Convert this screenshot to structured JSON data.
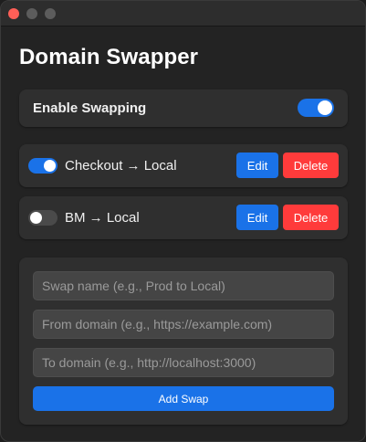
{
  "window": {
    "title": "Domain Swapper"
  },
  "settings": {
    "enable_label": "Enable Swapping",
    "enabled": true
  },
  "swaps": [
    {
      "name": "Checkout → Local",
      "enabled": true,
      "edit_label": "Edit",
      "delete_label": "Delete"
    },
    {
      "name": "BM → Local",
      "enabled": false,
      "edit_label": "Edit",
      "delete_label": "Delete"
    }
  ],
  "form": {
    "name_placeholder": "Swap name (e.g., Prod to Local)",
    "from_placeholder": "From domain (e.g., https://example.com)",
    "to_placeholder": "To domain (e.g., http://localhost:3000)",
    "name_value": "",
    "from_value": "",
    "to_value": "",
    "submit_label": "Add Swap"
  },
  "colors": {
    "accent": "#1a72e8",
    "danger": "#ff3b3b",
    "close": "#ff5f57"
  }
}
